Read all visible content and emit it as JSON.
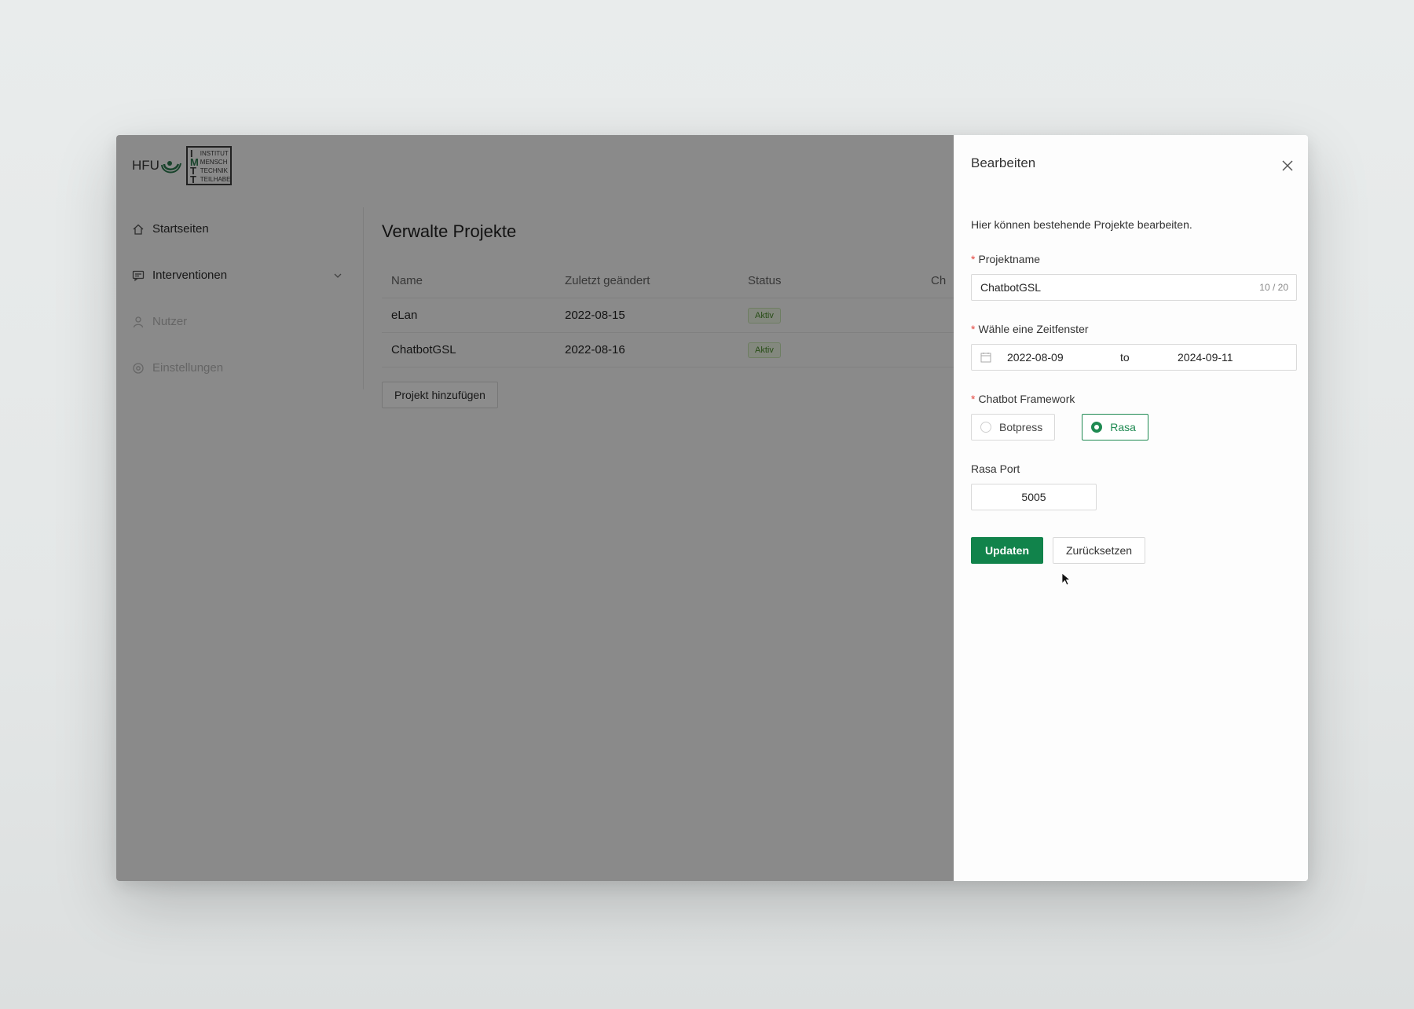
{
  "colors": {
    "accent": "#11834b",
    "mask": "rgba(0,0,0,0.45)",
    "tag_text": "#4a8c2a",
    "required": "#e4463f"
  },
  "logo": {
    "brand": "HFU",
    "box_letters": [
      "I",
      "M",
      "T",
      "T"
    ],
    "box_words": [
      "INSTITUT",
      "MENSCH",
      "TECHNIK",
      "TEILHABE"
    ]
  },
  "sidebar": {
    "items": [
      {
        "label": "Startseiten",
        "icon": "home-icon"
      },
      {
        "label": "Interventionen",
        "icon": "message-icon"
      },
      {
        "label": "Nutzer",
        "icon": "user-icon"
      },
      {
        "label": "Einstellungen",
        "icon": "settings-icon"
      }
    ]
  },
  "main": {
    "title": "Verwalte Projekte",
    "columns": [
      "Name",
      "Zuletzt geändert",
      "Status",
      "Ch"
    ],
    "rows": [
      {
        "name": "eLan",
        "date": "2022-08-15",
        "status": "Aktiv"
      },
      {
        "name": "ChatbotGSL",
        "date": "2022-08-16",
        "status": "Aktiv"
      }
    ],
    "add_button": "Projekt hinzufügen"
  },
  "drawer": {
    "title": "Bearbeiten",
    "description": "Hier können bestehende Projekte bearbeiten.",
    "project_name": {
      "label": "Projektname",
      "value": "ChatbotGSL",
      "count": "10 / 20"
    },
    "time_window": {
      "label": "Wähle eine Zeitfenster",
      "from": "2022-08-09",
      "separator": "to",
      "to": "2024-09-11"
    },
    "framework": {
      "label": "Chatbot Framework",
      "options": [
        "Botpress",
        "Rasa"
      ],
      "selected": "Rasa"
    },
    "port": {
      "label": "Rasa Port",
      "value": "5005"
    },
    "update_button": "Updaten",
    "reset_button": "Zurücksetzen"
  }
}
